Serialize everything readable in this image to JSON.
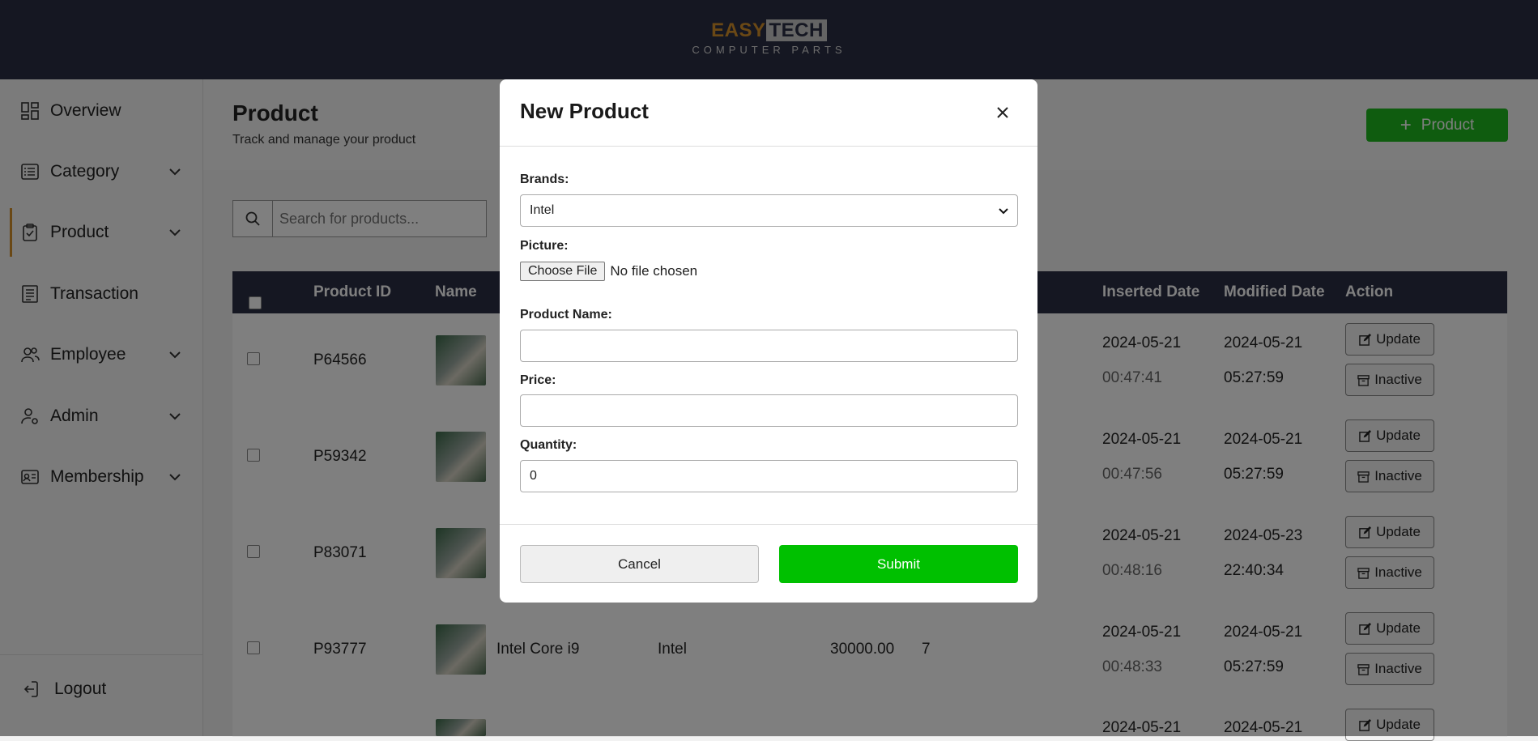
{
  "header": {
    "logo_part1": "EASY",
    "logo_part2": "TECH",
    "logo_sub": "COMPUTER PARTS"
  },
  "sidebar": {
    "items": [
      {
        "label": "Overview",
        "icon": "grid-icon"
      },
      {
        "label": "Category",
        "icon": "list-icon"
      },
      {
        "label": "Product",
        "icon": "clipboard-icon",
        "active": true
      },
      {
        "label": "Transaction",
        "icon": "receipt-icon"
      },
      {
        "label": "Employee",
        "icon": "users-icon"
      },
      {
        "label": "Admin",
        "icon": "user-gear-icon"
      },
      {
        "label": "Membership",
        "icon": "id-card-icon"
      }
    ],
    "logout": "Logout"
  },
  "page": {
    "title": "Product",
    "subtitle": "Track and manage your product",
    "add_button": "Product",
    "search_placeholder": "Search for products..."
  },
  "table": {
    "headers": {
      "id": "Product ID",
      "name": "Name",
      "inserted": "Inserted Date",
      "modified": "Modified Date",
      "action": "Action"
    },
    "rows": [
      {
        "id": "P64566",
        "name": "",
        "brand": "",
        "price": "",
        "qty": "",
        "ins_date": "2024-05-21",
        "ins_time": "00:47:41",
        "mod_date": "2024-05-21",
        "mod_time": "05:27:59"
      },
      {
        "id": "P59342",
        "name": "",
        "brand": "",
        "price": "",
        "qty": "",
        "ins_date": "2024-05-21",
        "ins_time": "00:47:56",
        "mod_date": "2024-05-21",
        "mod_time": "05:27:59"
      },
      {
        "id": "P83071",
        "name": "",
        "brand": "",
        "price": "",
        "qty": "",
        "ins_date": "2024-05-21",
        "ins_time": "00:48:16",
        "mod_date": "2024-05-23",
        "mod_time": "22:40:34"
      },
      {
        "id": "P93777",
        "name": "Intel Core i9",
        "brand": "Intel",
        "price": "30000.00",
        "qty": "7",
        "ins_date": "2024-05-21",
        "ins_time": "00:48:33",
        "mod_date": "2024-05-21",
        "mod_time": "05:27:59"
      },
      {
        "id": "",
        "name": "",
        "brand": "",
        "price": "",
        "qty": "",
        "ins_date": "2024-05-21",
        "ins_time": "",
        "mod_date": "2024-05-21",
        "mod_time": ""
      }
    ],
    "update_label": "Update",
    "inactive_label": "Inactive"
  },
  "modal": {
    "title": "New Product",
    "brands_label": "Brands:",
    "brands_value": "Intel",
    "picture_label": "Picture:",
    "choose_file": "Choose File",
    "no_file": "No file chosen",
    "name_label": "Product Name:",
    "name_value": "",
    "price_label": "Price:",
    "price_value": "",
    "qty_label": "Quantity:",
    "qty_value": "0",
    "cancel": "Cancel",
    "submit": "Submit"
  },
  "colors": {
    "header_bg": "#2b2e45",
    "accent_orange": "#d5902a",
    "green": "#1fb81f",
    "submit_green": "#00c000"
  }
}
